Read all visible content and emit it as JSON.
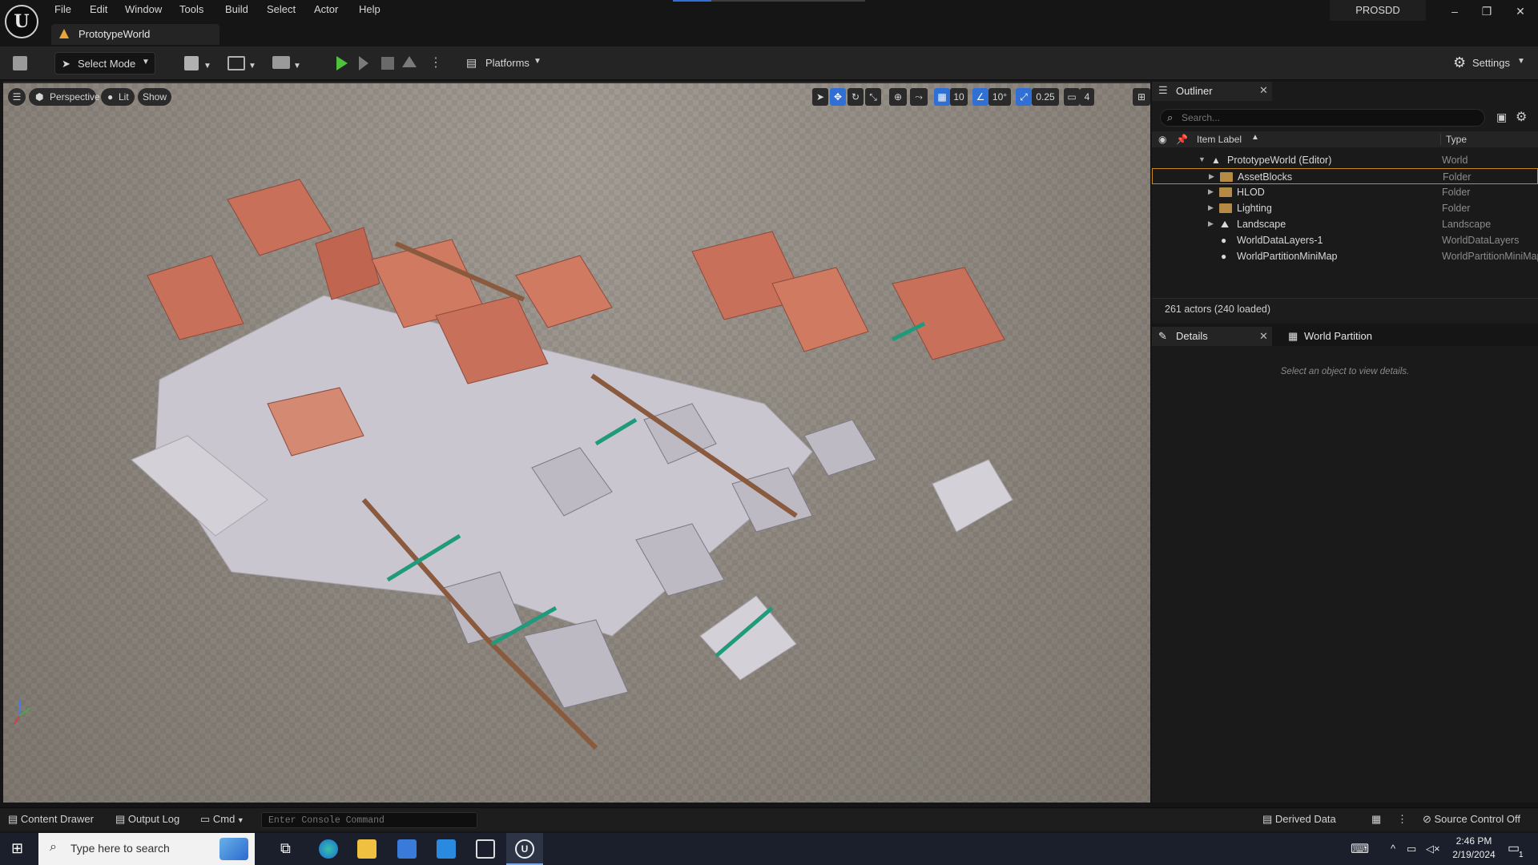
{
  "menubar": {
    "items": [
      "File",
      "Edit",
      "Window",
      "Tools",
      "Build",
      "Select",
      "Actor",
      "Help"
    ]
  },
  "level_tab": {
    "label": "PrototypeWorld"
  },
  "project_badge": "PROSDD",
  "title_progress": 0.2,
  "window_controls": {
    "minimize": "–",
    "restore": "❐",
    "close": "✕"
  },
  "toolbar": {
    "select_mode": "Select Mode",
    "platforms": "Platforms",
    "settings": "Settings"
  },
  "viewport": {
    "perspective": "Perspective",
    "lit": "Lit",
    "show": "Show",
    "grid_snap": "10",
    "rotation_snap": "10°",
    "scale_snap": "0.25",
    "camera_speed": "4"
  },
  "outliner": {
    "title": "Outliner",
    "search_placeholder": "Search...",
    "col_label": "Item Label",
    "col_type": "Type",
    "rows": [
      {
        "label": "PrototypeWorld (Editor)",
        "type": "World"
      },
      {
        "label": "AssetBlocks",
        "type": "Folder"
      },
      {
        "label": "HLOD",
        "type": "Folder"
      },
      {
        "label": "Lighting",
        "type": "Folder"
      },
      {
        "label": "Landscape",
        "type": "Landscape"
      },
      {
        "label": "WorldDataLayers-1",
        "type": "WorldDataLayers"
      },
      {
        "label": "WorldPartitionMiniMap",
        "type": "WorldPartitionMiniMap"
      }
    ],
    "actor_count": "261 actors (240 loaded)"
  },
  "details": {
    "tab_details": "Details",
    "tab_world_partition": "World Partition",
    "empty_message": "Select an object to view details."
  },
  "statusbar": {
    "content_drawer": "Content Drawer",
    "output_log": "Output Log",
    "cmd": "Cmd",
    "console_placeholder": "Enter Console Command",
    "derived_data": "Derived Data",
    "source_control": "Source Control Off"
  },
  "taskbar": {
    "search_placeholder": "Type here to search",
    "time": "2:46 PM",
    "date": "2/19/2024",
    "notif_count": "1"
  },
  "colors": {
    "play_green": "#4fc13a",
    "accent_blue": "#2f6fd6",
    "folder": "#b58a44",
    "selection_outline": "#c88a1f"
  }
}
